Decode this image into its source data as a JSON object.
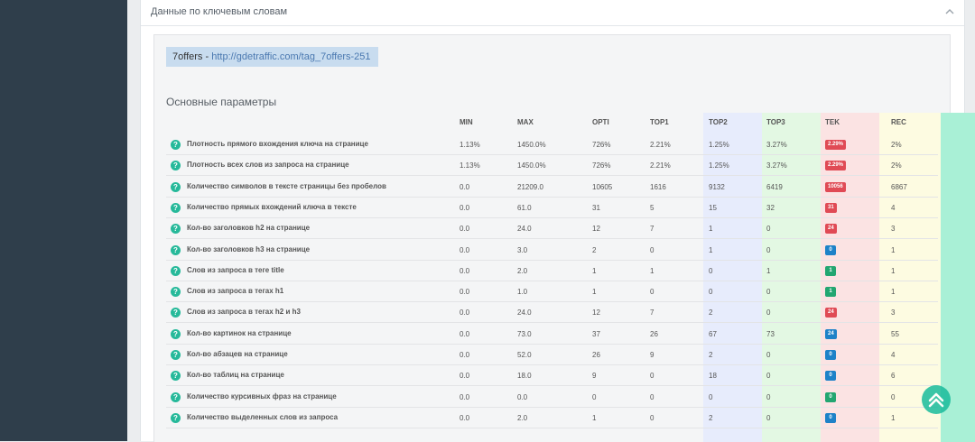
{
  "panel": {
    "title": "Данные по ключевым словам"
  },
  "site": {
    "name": "7offers",
    "separator": " - ",
    "url": "http://gdetraffic.com/tag_7offers-251"
  },
  "section_title": "Основные параметры",
  "columns": [
    "MIN",
    "MAX",
    "OPTI",
    "TOP1",
    "TOP2",
    "TOP3",
    "TEK",
    "REC"
  ],
  "colors": {
    "top1": "#e7ecfc",
    "top2": "#e3f8e3",
    "top3": "#fbe3e3",
    "tek": "#fdfbe1",
    "rec": "#a9f0d6",
    "badge_red": "#e04a55",
    "badge_green": "#23a671",
    "badge_blue": "#1e82c8"
  },
  "rows": [
    {
      "label": "Плотность прямого вхождения ключа на странице",
      "min": "1.13%",
      "max": "1450.0%",
      "opti": "726%",
      "top1": "2.21%",
      "top2": "1.25%",
      "top3": "3.27%",
      "tek": "2.29%",
      "tek_color": "red",
      "rec": "2%"
    },
    {
      "label": "Плотность всех слов из запроса на странице",
      "min": "1.13%",
      "max": "1450.0%",
      "opti": "726%",
      "top1": "2.21%",
      "top2": "1.25%",
      "top3": "3.27%",
      "tek": "2.29%",
      "tek_color": "red",
      "rec": "2%"
    },
    {
      "label": "Количество символов в тексте страницы без пробелов",
      "min": "0.0",
      "max": "21209.0",
      "opti": "10605",
      "top1": "1616",
      "top2": "9132",
      "top3": "6419",
      "tek": "10056",
      "tek_color": "red",
      "rec": "6867"
    },
    {
      "label": "Количество прямых вхождений ключа в тексте",
      "min": "0.0",
      "max": "61.0",
      "opti": "31",
      "top1": "5",
      "top2": "15",
      "top3": "32",
      "tek": "31",
      "tek_color": "red",
      "rec": "4"
    },
    {
      "label": "Кол-во заголовков h2 на странице",
      "min": "0.0",
      "max": "24.0",
      "opti": "12",
      "top1": "7",
      "top2": "1",
      "top3": "0",
      "tek": "24",
      "tek_color": "red",
      "rec": "3"
    },
    {
      "label": "Кол-во заголовков h3 на странице",
      "min": "0.0",
      "max": "3.0",
      "opti": "2",
      "top1": "0",
      "top2": "1",
      "top3": "0",
      "tek": "0",
      "tek_color": "blue",
      "rec": "1"
    },
    {
      "label": "Слов из запроса в теге title",
      "min": "0.0",
      "max": "2.0",
      "opti": "1",
      "top1": "1",
      "top2": "0",
      "top3": "1",
      "tek": "1",
      "tek_color": "green",
      "rec": "1"
    },
    {
      "label": "Слов из запроса в тегах h1",
      "min": "0.0",
      "max": "1.0",
      "opti": "1",
      "top1": "0",
      "top2": "0",
      "top3": "0",
      "tek": "1",
      "tek_color": "green",
      "rec": "1"
    },
    {
      "label": "Слов из запроса в тегах h2 и h3",
      "min": "0.0",
      "max": "24.0",
      "opti": "12",
      "top1": "7",
      "top2": "2",
      "top3": "0",
      "tek": "24",
      "tek_color": "red",
      "rec": "3"
    },
    {
      "label": "Кол-во картинок на странице",
      "min": "0.0",
      "max": "73.0",
      "opti": "37",
      "top1": "26",
      "top2": "67",
      "top3": "73",
      "tek": "24",
      "tek_color": "blue",
      "rec": "55"
    },
    {
      "label": "Кол-во абзацев на странице",
      "min": "0.0",
      "max": "52.0",
      "opti": "26",
      "top1": "9",
      "top2": "2",
      "top3": "0",
      "tek": "0",
      "tek_color": "blue",
      "rec": "4"
    },
    {
      "label": "Кол-во таблиц на странице",
      "min": "0.0",
      "max": "18.0",
      "opti": "9",
      "top1": "0",
      "top2": "18",
      "top3": "0",
      "tek": "0",
      "tek_color": "blue",
      "rec": "6"
    },
    {
      "label": "Количество курсивных фраз на странице",
      "min": "0.0",
      "max": "0.0",
      "opti": "0",
      "top1": "0",
      "top2": "0",
      "top3": "0",
      "tek": "0",
      "tek_color": "green",
      "rec": "0"
    },
    {
      "label": "Количество выделенных слов из запроса",
      "min": "0.0",
      "max": "2.0",
      "opti": "1",
      "top1": "0",
      "top2": "2",
      "top3": "0",
      "tek": "0",
      "tek_color": "blue",
      "rec": "1"
    }
  ]
}
